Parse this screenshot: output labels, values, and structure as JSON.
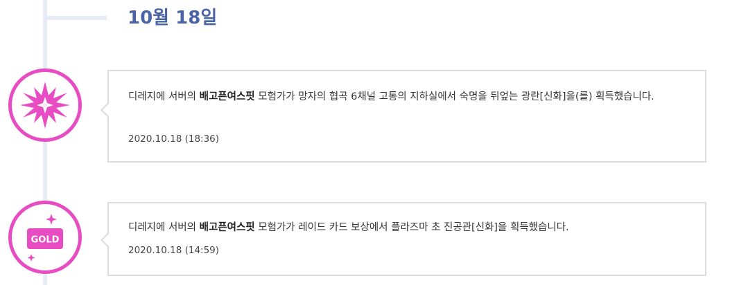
{
  "date_heading": "10월 18일",
  "events": [
    {
      "icon": "starburst-icon",
      "prefix": "디레지에 서버의 ",
      "character": "배고픈여스핏",
      "suffix": " 모험가가 망자의 협곡 6채널 고통의 지하실에서 숙명을 뒤엎는 광란[신화]을(를) 획득했습니다.",
      "timestamp": "2020.10.18 (18:36)"
    },
    {
      "icon": "gold-icon",
      "icon_label": "GOLD",
      "prefix": "디레지에 서버의 ",
      "character": "배고픈여스핏",
      "suffix": " 모험가가 레이드 카드 보상에서 플라즈마 초 진공관[신화]을 획득했습니다.",
      "timestamp": "2020.10.18 (14:59)"
    }
  ],
  "colors": {
    "accent": "#e84cc3",
    "date": "#4b64a6",
    "timeline": "#e7ebf6",
    "card_border": "#dcdcdc"
  }
}
